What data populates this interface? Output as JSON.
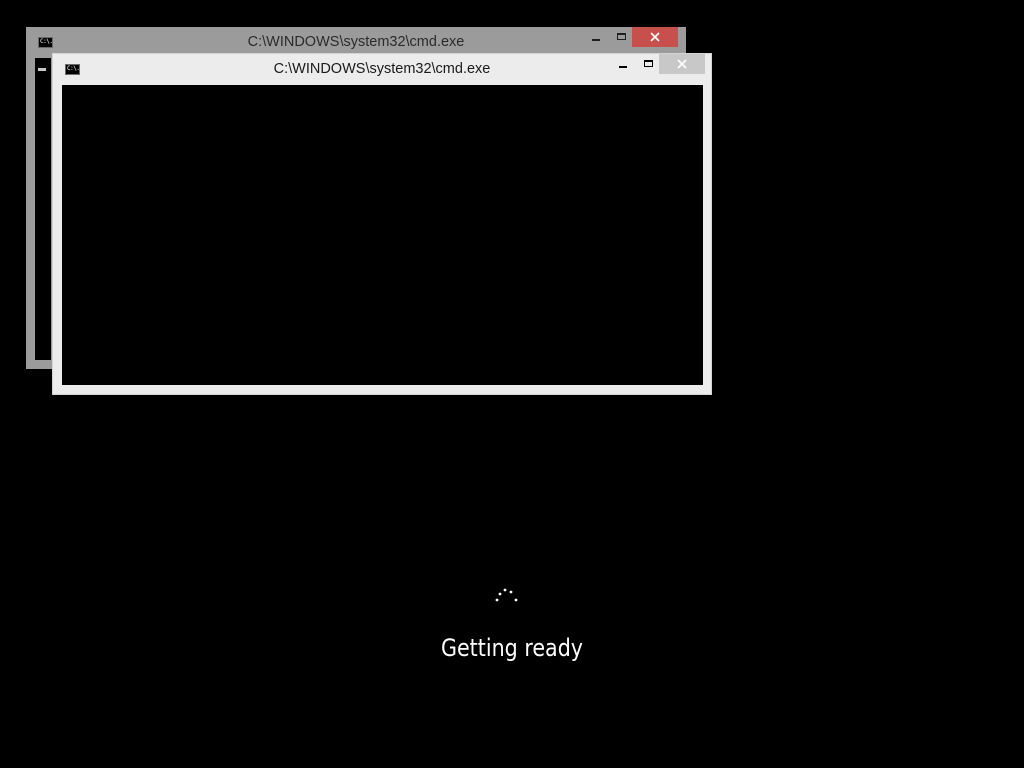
{
  "windows": [
    {
      "title": "C:\\WINDOWS\\system32\\cmd.exe",
      "icon": "cmd-icon",
      "icon_text": "C:\\.",
      "state": "inactive"
    },
    {
      "title": "C:\\WINDOWS\\system32\\cmd.exe",
      "icon": "cmd-icon",
      "icon_text": "C:\\.",
      "state": "active"
    }
  ],
  "status": {
    "text": "Getting ready",
    "icon": "loading-spinner-icon"
  },
  "colors": {
    "background": "#000000",
    "inactive_frame": "#9b9b9b",
    "active_frame": "#ececec",
    "close_button_inactive": "#c7504c",
    "close_button_active": "#c8c8c8",
    "text": "#ffffff"
  }
}
